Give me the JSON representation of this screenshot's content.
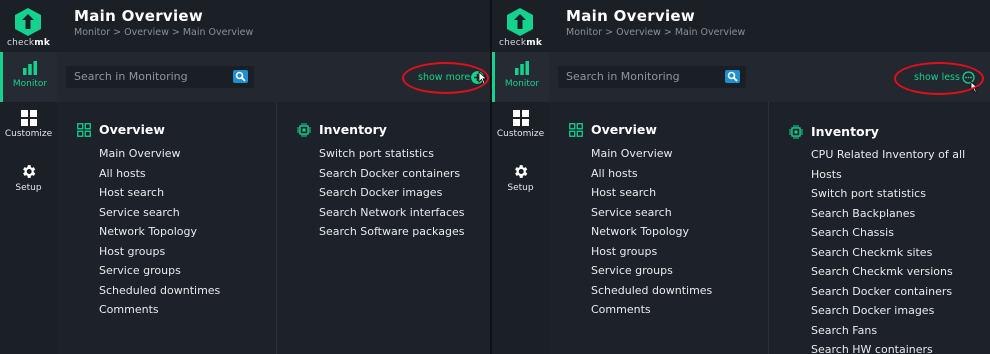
{
  "app": {
    "logo_text_a": "check",
    "logo_text_b": "mk",
    "brand_color": "#13d38e"
  },
  "nav": {
    "monitor": "Monitor",
    "customize": "Customize",
    "setup": "Setup"
  },
  "header": {
    "title": "Main Overview",
    "breadcrumb": "Monitor > Overview > Main Overview"
  },
  "search": {
    "placeholder": "Search in Monitoring"
  },
  "left": {
    "toggle": "show more",
    "overview": {
      "title": "Overview",
      "items": [
        "Main Overview",
        "All hosts",
        "Host search",
        "Service search",
        "Network Topology",
        "Host groups",
        "Service groups",
        "Scheduled downtimes",
        "Comments"
      ]
    },
    "inventory": {
      "title": "Inventory",
      "items": [
        "Switch port statistics",
        "Search Docker containers",
        "Search Docker images",
        "Search Network interfaces",
        "Search Software packages"
      ]
    }
  },
  "right": {
    "toggle": "show less",
    "overview": {
      "title": "Overview",
      "items": [
        "Main Overview",
        "All hosts",
        "Host search",
        "Service search",
        "Network Topology",
        "Host groups",
        "Service groups",
        "Scheduled downtimes",
        "Comments"
      ]
    },
    "inventory": {
      "title": "Inventory",
      "items": [
        "CPU Related Inventory of all",
        "Hosts",
        "Switch port statistics",
        "Search Backplanes",
        "Search Chassis",
        "Search Checkmk sites",
        "Search Checkmk versions",
        "Search Docker containers",
        "Search Docker images",
        "Search Fans",
        "Search HW containers"
      ]
    }
  }
}
